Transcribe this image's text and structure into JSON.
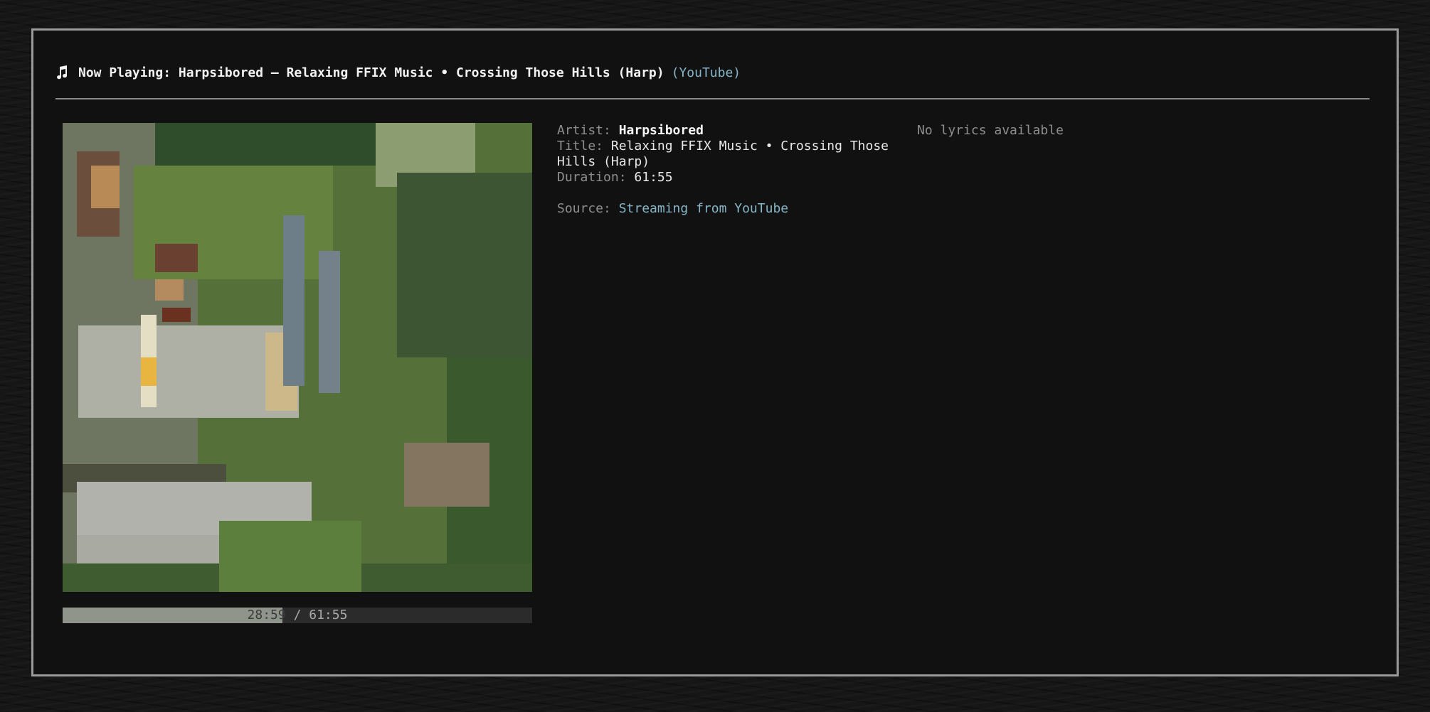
{
  "header": {
    "icon": "music-note-icon",
    "now_playing": "Now Playing: Harpsibored – Relaxing FFIX Music • Crossing Those Hills (Harp)",
    "source_link": "(YouTube)"
  },
  "track": {
    "artist_label": "Artist:",
    "artist": "Harpsibored",
    "title_label": "Title:",
    "title": "Relaxing FFIX Music • Crossing Those Hills (Harp)",
    "duration_label": "Duration:",
    "duration": "61:55",
    "source_label": "Source:",
    "source": "Streaming from YouTube"
  },
  "progress": {
    "current": "28:59",
    "separator": " / ",
    "total": "61:55",
    "fraction": 0.468
  },
  "lyrics": {
    "text": "No lyrics available"
  },
  "colors": {
    "accent": "#86b7c9",
    "panel_bg": "#111111",
    "border": "#9a9a9a",
    "progress_fill": "#8f958a",
    "progress_track": "#2b2b2b"
  }
}
